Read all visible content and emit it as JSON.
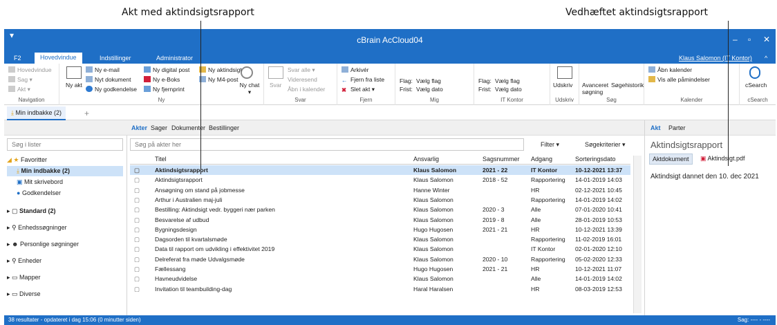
{
  "annotations": {
    "left": "Akt med aktindsigtsrapport",
    "right": "Vedhæftet aktindsigtsrapport"
  },
  "window": {
    "title": "cBrain AcCloud04",
    "user": "Klaus Salomon (IT Kontor)"
  },
  "tabs": [
    "F2",
    "Hovedvindue",
    "Indstillinger",
    "Administrator"
  ],
  "ribbon": {
    "navigation": {
      "items": [
        "Hovedvindue",
        "Sag ▾",
        "Akt ▾"
      ],
      "label": "Navigation"
    },
    "ny": {
      "big": "Ny akt",
      "items": [
        "Ny e-mail",
        "Nyt dokument",
        "Ny godkendelse",
        "Ny digital post",
        "Ny e-Boks",
        "Ny fjernprint",
        "Ny aktindsigt",
        "Ny M4-post"
      ],
      "chat": "Ny chat ▾",
      "label": "Ny"
    },
    "svar": {
      "big": "Svar",
      "items": [
        "Svar alle ▾",
        "Videresend",
        "Åbn i kalender"
      ],
      "label": "Svar"
    },
    "fjern": {
      "items": [
        "Arkivér",
        "Fjern fra liste",
        "Slet akt ▾"
      ],
      "label": "Fjern"
    },
    "mig": {
      "flag": "Flag:",
      "flag_v": "Vælg flag",
      "frist": "Frist:",
      "frist_v": "Vælg dato",
      "label": "Mig"
    },
    "itk": {
      "flag": "Flag:",
      "flag_v": "Vælg flag",
      "frist": "Frist:",
      "frist_v": "Vælg dato",
      "label": "IT Kontor"
    },
    "udskriv": {
      "big": "Udskriv",
      "label": "Udskriv"
    },
    "sog": {
      "a": "Avanceret søgning",
      "b": "Søgehistorik",
      "label": "Søg"
    },
    "kalender": {
      "a": "Åbn kalender",
      "b": "Vis alle påmindelser",
      "label": "Kalender"
    },
    "csearch": {
      "big": "cSearch",
      "label": "cSearch"
    }
  },
  "doctab": "Min indbakke (2)",
  "left": {
    "search": "Søg i lister",
    "items": [
      {
        "t": "Favoritter"
      },
      {
        "t": "Min indbakke (2)"
      },
      {
        "t": "Mit skrivebord"
      },
      {
        "t": "Godkendelser"
      },
      {
        "t": "Standard (2)"
      },
      {
        "t": "Enhedssøgninger"
      },
      {
        "t": "Personlige søgninger"
      },
      {
        "t": "Enheder"
      },
      {
        "t": "Mapper"
      },
      {
        "t": "Diverse"
      }
    ]
  },
  "center": {
    "tabs": [
      "Akter",
      "Sager",
      "Dokumenter",
      "Bestillinger"
    ],
    "search": "Søg på akter her",
    "filter": "Filter ▾",
    "criteria": "Søgekriterier ▾",
    "cols": [
      "Titel",
      "Ansvarlig",
      "Sagsnummer",
      "Adgang",
      "Sorteringsdato"
    ],
    "rows": [
      [
        "Aktindsigtsrapport",
        "Klaus Salomon",
        "2021 - 22",
        "IT Kontor",
        "10-12-2021 13:37"
      ],
      [
        "Aktindsigtsrapport",
        "Klaus Salomon",
        "2018 - 52",
        "Rapportering",
        "14-01-2019 14:03"
      ],
      [
        "Ansøgning om stand på jobmesse",
        "Hanne Winter",
        "",
        "HR",
        "02-12-2021 10:45"
      ],
      [
        "Arthur i Australien maj-juli",
        "Klaus Salomon",
        "",
        "Rapportering",
        "14-01-2019 14:02"
      ],
      [
        "Bestilling: Aktindsigt vedr. byggeri nær parken",
        "Klaus Salomon",
        "2020 - 3",
        "Alle",
        "07-01-2020 10:41"
      ],
      [
        "Besvarelse af udbud",
        "Klaus Salomon",
        "2019 - 8",
        "Alle",
        "28-01-2019 10:53"
      ],
      [
        "Bygningsdesign",
        "Hugo Hugosen",
        "2021 - 21",
        "HR",
        "10-12-2021 13:39"
      ],
      [
        "Dagsorden til kvartalsmøde",
        "Klaus Salomon",
        "",
        "Rapportering",
        "11-02-2019 16:01"
      ],
      [
        "Data til rapport om udvikling i effektivitet 2019",
        "Klaus Salomon",
        "",
        "IT Kontor",
        "02-01-2020 12:10"
      ],
      [
        "Delreferat fra møde Udvalgsmøde",
        "Klaus Salomon",
        "2020 - 10",
        "Rapportering",
        "05-02-2020 12:33"
      ],
      [
        "Fællessang",
        "Hugo Hugosen",
        "2021 - 21",
        "HR",
        "10-12-2021 11:07"
      ],
      [
        "Havneudvidelse",
        "Klaus Salomon",
        "",
        "Alle",
        "14-01-2019 14:02"
      ],
      [
        "Invitation til teambuilding-dag",
        "Haral Haralsen",
        "",
        "HR",
        "08-03-2019 12:53"
      ]
    ]
  },
  "right": {
    "tabs": [
      "Akt",
      "Parter"
    ],
    "title": "Aktindsigtsrapport",
    "doctab": "Aktdokument",
    "file": "Aktindsigt.pdf",
    "text": "Aktindsigt dannet den 10. dec 2021"
  },
  "status": {
    "left": "38 resultater - opdateret i dag 15:06 (0 minutter siden)",
    "right": "Sag: ---- - ----"
  }
}
